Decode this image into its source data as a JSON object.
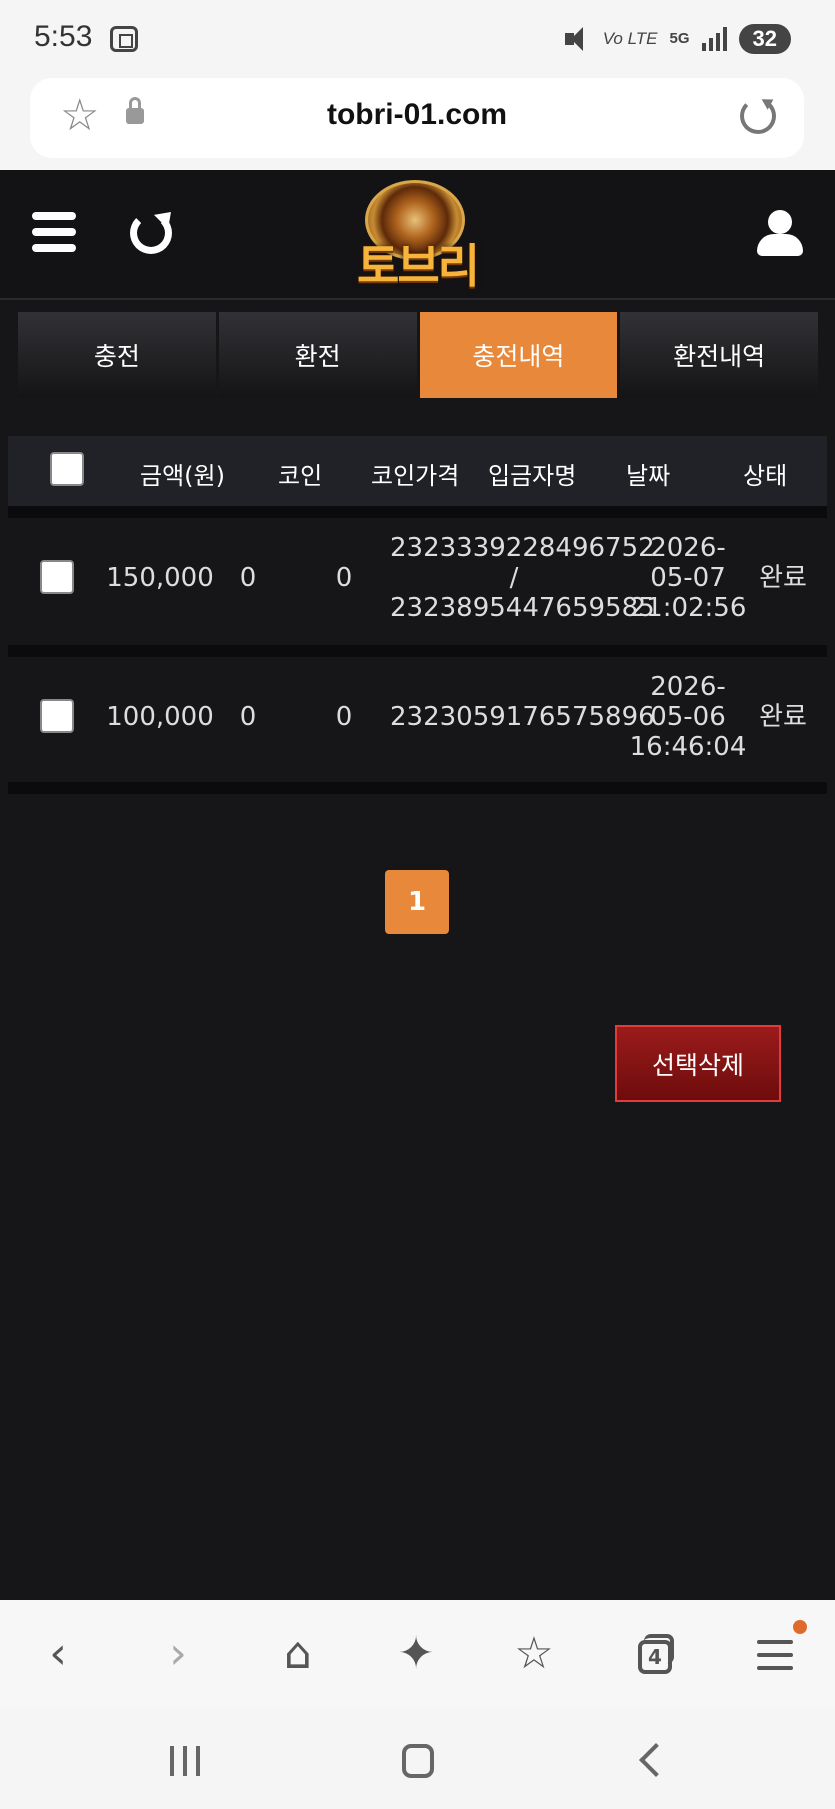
{
  "status_bar": {
    "time": "5:53",
    "volte": "Vo LTE",
    "network": "5G",
    "battery": "32"
  },
  "url_bar": {
    "url": "tobri-01.com"
  },
  "site": {
    "logo_text": "토브리",
    "tabs": [
      {
        "label": "충전",
        "active": false
      },
      {
        "label": "환전",
        "active": false
      },
      {
        "label": "충전내역",
        "active": true
      },
      {
        "label": "환전내역",
        "active": false
      }
    ],
    "table": {
      "headers": [
        "금액(원)",
        "코인",
        "코인가격",
        "입금자명",
        "날짜",
        "상태"
      ],
      "rows": [
        {
          "amount": "150,000",
          "coin": "0",
          "coin_price": "0",
          "depositor_line1": "2323339228496752",
          "depositor_line2": "/",
          "depositor_line3": "2323895447659585",
          "date_line1": "2026-",
          "date_line2": "05-07",
          "date_line3": "21:02:56",
          "status": "완료"
        },
        {
          "amount": "100,000",
          "coin": "0",
          "coin_price": "0",
          "depositor_line1": "2323059176575896",
          "date_line1": "2026-",
          "date_line2": "05-06",
          "date_line3": "16:46:04",
          "status": "완료"
        }
      ]
    },
    "pagination": {
      "current_page": "1"
    },
    "delete_button_label": "선택삭제"
  },
  "browser_bar": {
    "tab_count": "4",
    "icons": [
      "back-icon",
      "forward-icon",
      "home-icon",
      "sparkle-icon",
      "bookmarks-icon",
      "tabs-icon",
      "menu-icon"
    ]
  },
  "colors": {
    "accent": "#e8883a",
    "page_bg": "#161619",
    "delete_red": "#8b1515"
  }
}
